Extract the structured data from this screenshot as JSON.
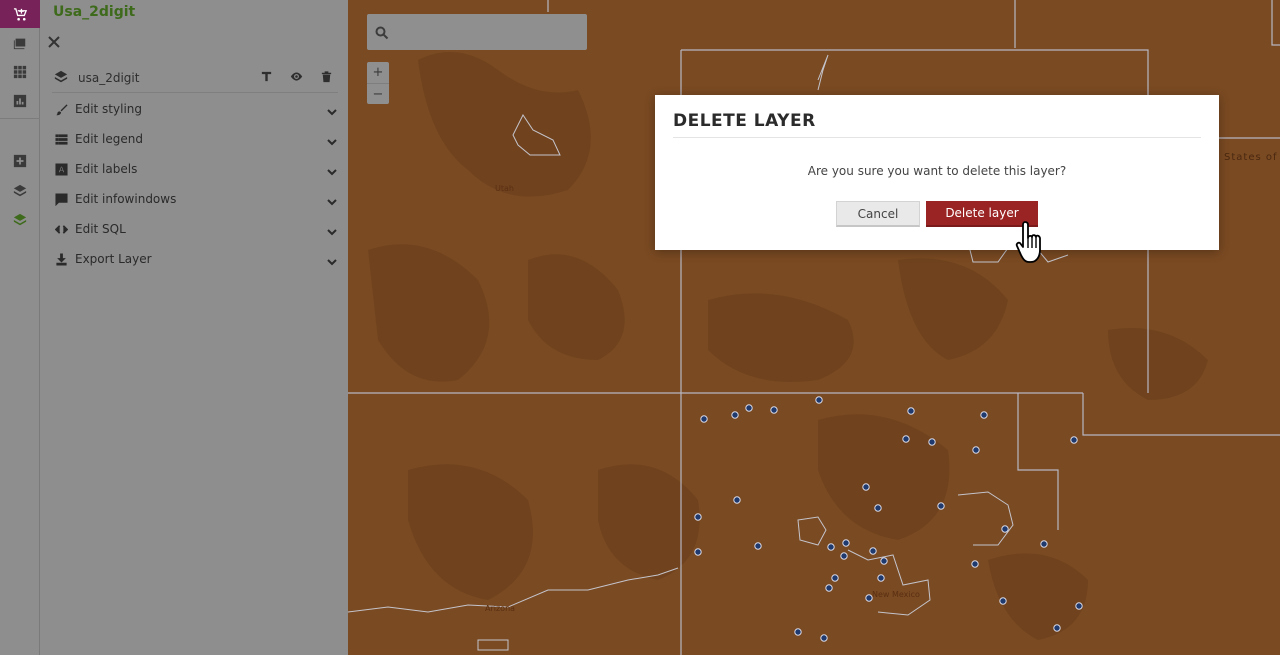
{
  "app": {
    "title": "Usa_2digit"
  },
  "layer": {
    "name": "usa_2digit"
  },
  "menu": [
    {
      "label": "Edit styling",
      "icon": "brush-icon"
    },
    {
      "label": "Edit legend",
      "icon": "list-icon"
    },
    {
      "label": "Edit labels",
      "icon": "label-a-icon"
    },
    {
      "label": "Edit infowindows",
      "icon": "comment-icon"
    },
    {
      "label": "Edit SQL",
      "icon": "code-icon"
    },
    {
      "label": "Export Layer",
      "icon": "download-icon"
    }
  ],
  "search": {
    "placeholder": ""
  },
  "map": {
    "labels": {
      "utah": "Utah",
      "new_mexico": "New Mexico",
      "arizona": "Arizona",
      "state": "States of"
    }
  },
  "modal": {
    "title": "DELETE LAYER",
    "message": "Are you sure you want to delete this layer?",
    "cancel": "Cancel",
    "confirm": "Delete layer"
  },
  "colors": {
    "brand": "#77235a",
    "title_green": "#3e6a1b",
    "danger": "#9a2323",
    "map_fill": "#7a4a22",
    "point": "#1f3a6e"
  }
}
